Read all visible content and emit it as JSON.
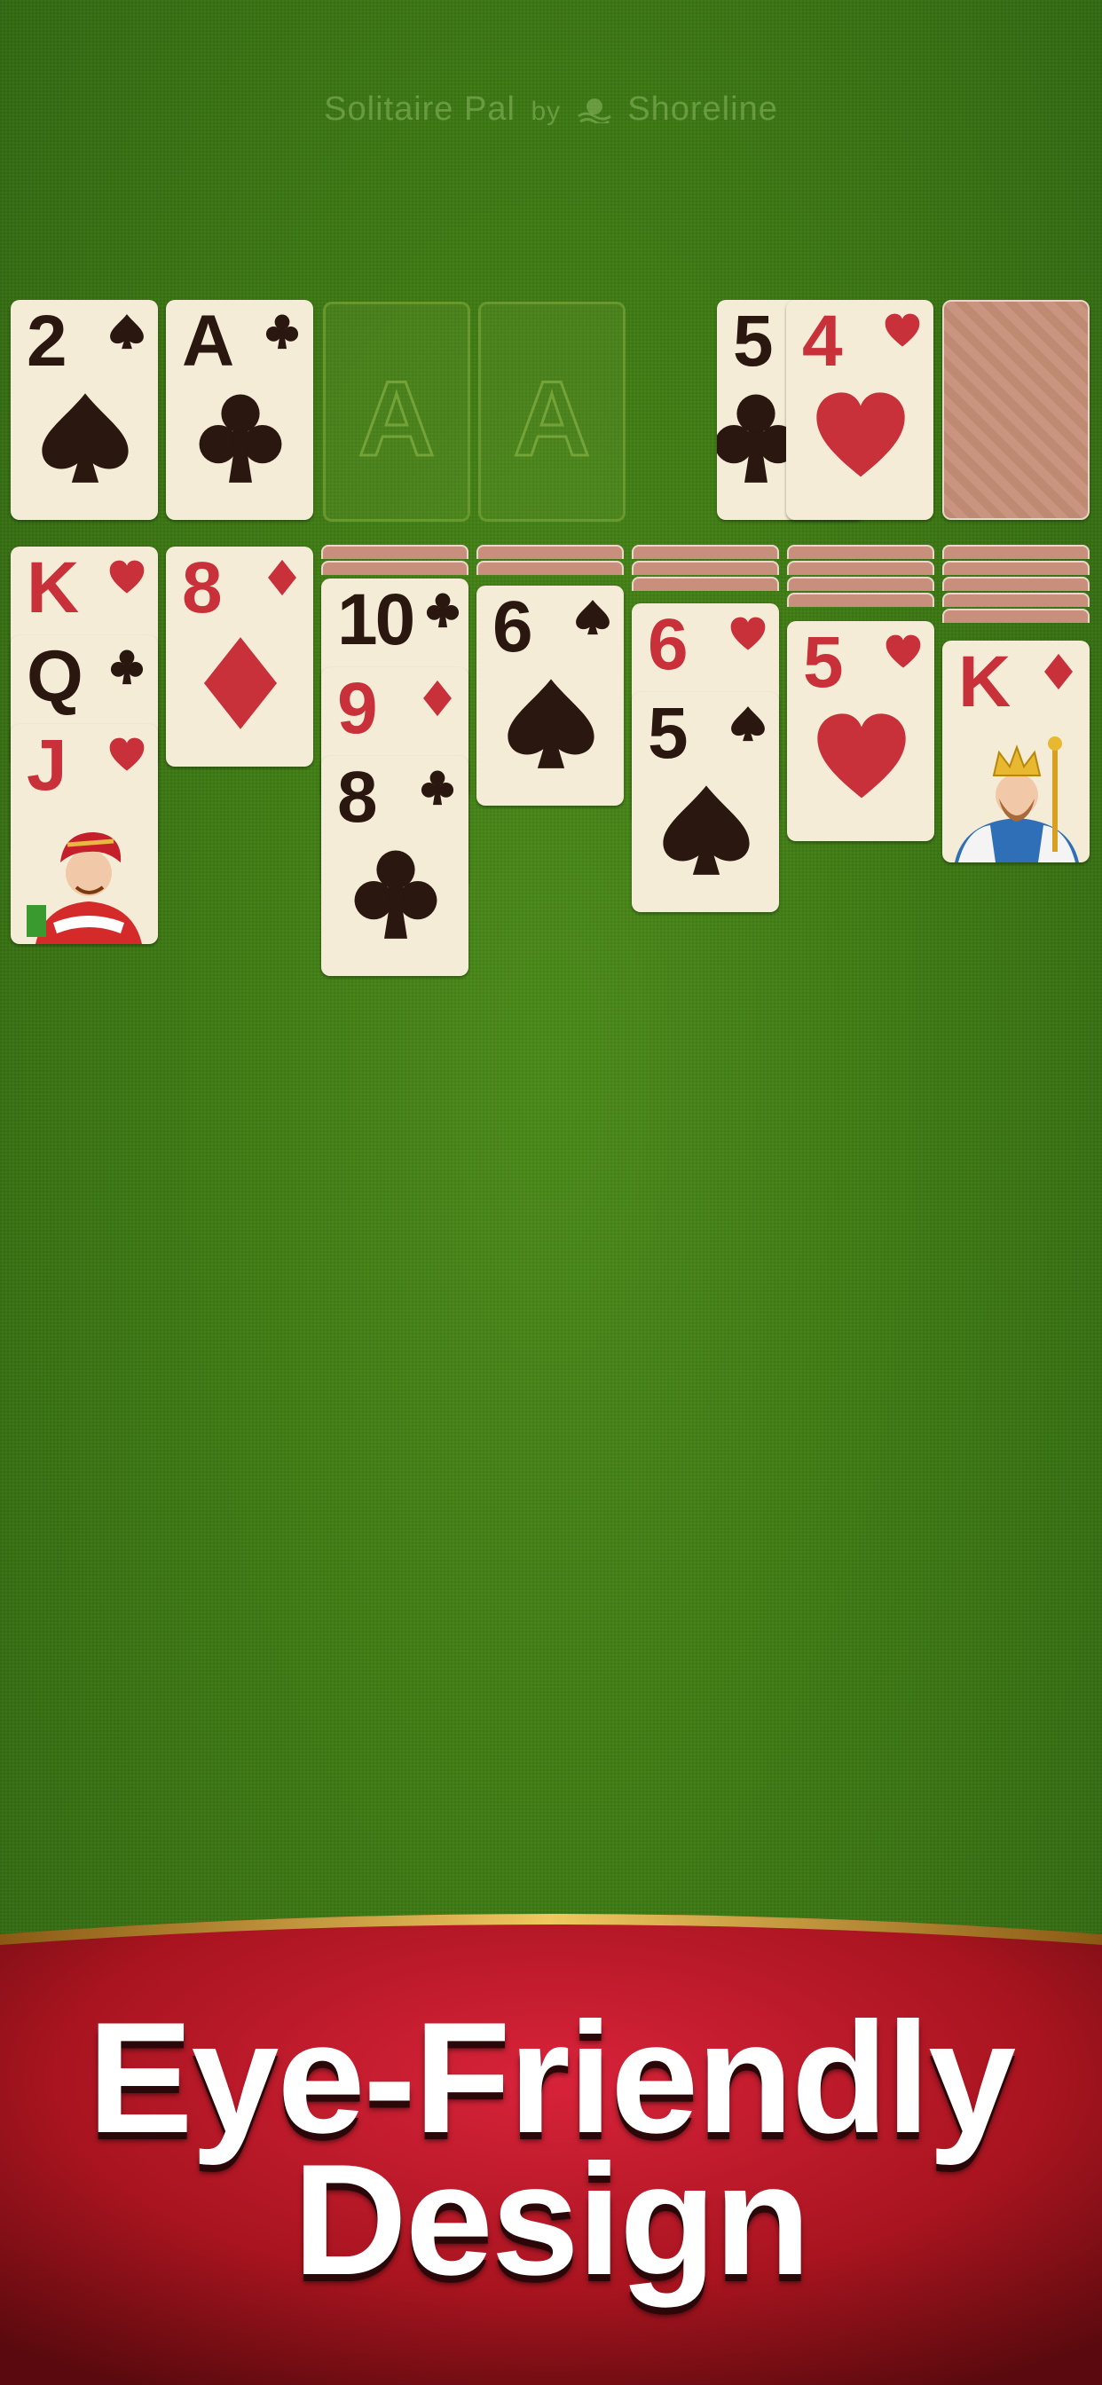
{
  "brand": {
    "title": "Solitaire Pal",
    "by": "by",
    "company": "Shoreline"
  },
  "headline": {
    "line1": "Eye-Friendly",
    "line2": "Design"
  },
  "colors": {
    "felt": "#3d7a12",
    "banner": "#b81d2e",
    "gold": "#c9952d",
    "red_suit": "#c8303a",
    "black_suit": "#2a1710"
  },
  "foundations": [
    {
      "rank": "2",
      "suit": "spade-icon"
    },
    {
      "rank": "A",
      "suit": "club-icon"
    },
    {
      "placeholder": "A"
    },
    {
      "placeholder": "A"
    }
  ],
  "waste": [
    {
      "rank": "5",
      "suit": "club-icon"
    },
    {
      "rank": "4",
      "suit": "heart-icon"
    }
  ],
  "tableau": [
    {
      "hidden": 0,
      "cards": [
        {
          "rank": "K",
          "suit": "heart-icon"
        },
        {
          "rank": "Q",
          "suit": "club-icon"
        },
        {
          "rank": "J",
          "suit": "heart-icon"
        }
      ]
    },
    {
      "hidden": 0,
      "cards": [
        {
          "rank": "8",
          "suit": "diamond-icon"
        }
      ]
    },
    {
      "hidden": 2,
      "cards": [
        {
          "rank": "10",
          "suit": "club-icon"
        },
        {
          "rank": "9",
          "suit": "diamond-icon"
        },
        {
          "rank": "8",
          "suit": "club-icon"
        }
      ]
    },
    {
      "hidden": 2,
      "cards": [
        {
          "rank": "6",
          "suit": "spade-icon"
        }
      ]
    },
    {
      "hidden": 3,
      "cards": [
        {
          "rank": "6",
          "suit": "heart-icon"
        },
        {
          "rank": "5",
          "suit": "spade-icon"
        }
      ]
    },
    {
      "hidden": 4,
      "cards": [
        {
          "rank": "5",
          "suit": "heart-icon"
        }
      ]
    },
    {
      "hidden": 5,
      "cards": [
        {
          "rank": "K",
          "suit": "diamond-icon"
        }
      ]
    }
  ]
}
